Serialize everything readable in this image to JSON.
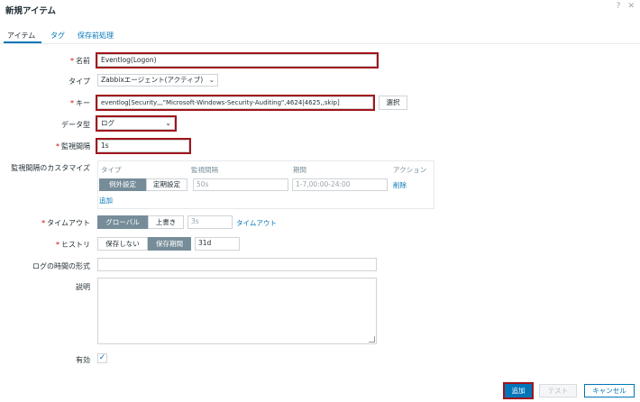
{
  "dialog": {
    "title": "新規アイテム",
    "help_icon": "help-icon",
    "close_icon": "close-icon"
  },
  "tabs": [
    "アイテム",
    "タグ",
    "保存前処理"
  ],
  "form": {
    "name": {
      "label": "名前",
      "value": "Eventlog(Logon)"
    },
    "type": {
      "label": "タイプ",
      "value": "Zabbixエージェント(アクティブ)"
    },
    "key": {
      "label": "キー",
      "value": "eventlog[Security,,,\"Microsoft-Windows-Security-Auditing\",4624|4625,,skip]",
      "select_button": "選択"
    },
    "data_type": {
      "label": "データ型",
      "value": "ログ"
    },
    "interval": {
      "label": "監視間隔",
      "value": "1s"
    },
    "custom_intervals": {
      "label": "監視間隔のカスタマイズ",
      "col_type": "タイプ",
      "col_interval": "監視間隔",
      "col_period": "期間",
      "col_action": "アクション",
      "seg_flexible": "例外設定",
      "seg_scheduling": "定期設定",
      "interval_placeholder": "50s",
      "period_placeholder": "1-7,00:00-24:00",
      "remove_link": "削除",
      "add_link": "追加"
    },
    "timeout": {
      "label": "タイムアウト",
      "seg_global": "グローバル",
      "seg_override": "上書き",
      "value": "3s",
      "link": "タイムアウト"
    },
    "history": {
      "label": "ヒストリ",
      "seg_dont_store": "保存しない",
      "seg_store": "保存期間",
      "value": "31d"
    },
    "log_time_format": {
      "label": "ログの時間の形式",
      "value": ""
    },
    "description": {
      "label": "説明",
      "value": ""
    },
    "enabled": {
      "label": "有効",
      "checked": true
    }
  },
  "footer": {
    "add_button": "追加",
    "test_button": "テスト",
    "cancel_button": "キャンセル"
  },
  "colors": {
    "accent": "#0275b8",
    "highlight": "#a1141b",
    "segment_active": "#768d99"
  }
}
